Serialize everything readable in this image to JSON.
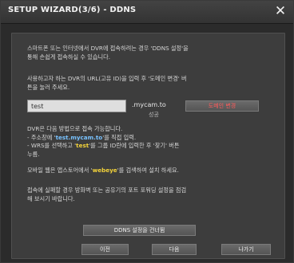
{
  "window": {
    "title": "SETUP WIZARD(3/6) - DDNS",
    "close_glyph": "✕"
  },
  "intro": "스마트폰 또는 인터넷에서 DVR에 접속하려는 경우 'DDNS 설정'을\n통해 손쉽게 접속하실 수 있습니다.",
  "url_help": "사용하고자 하는 DVR의 URL(고유 ID)을 입력 후 '도메인 변경' 버\n튼을 눌러 주세요.",
  "domain": {
    "value": "test",
    "suffix": ".mycam.to",
    "status": "성공",
    "change_button": "도메인 변경"
  },
  "access": {
    "line1": "DVR은 다음 방법으로 접속 가능합니다.",
    "line2_pre": "- 주소창에 '",
    "line2_hl": "test.mycam.to",
    "line2_post": "'를 직접 입력.",
    "line3_pre": "- WRS를 선택하고 '",
    "line3_hl": "test",
    "line3_post": "'를 그룹 ID란에 입력한 후 '찾기' 버튼",
    "line4": "누름."
  },
  "mobile": {
    "pre": "모바일 웹은 앱스토어에서 '",
    "hl": "webeye",
    "post": "'를 검색하여 설치 하세요."
  },
  "failure_note": "접속에 실패할 경우 방화벽 또는 공유기의 포트 포워딩 설정을 점검\n해 보시기 바랍니다.",
  "buttons": {
    "skip": "DDNS 설정을 건너뜀",
    "prev": "이전",
    "next": "다음",
    "exit": "나가기"
  },
  "colors": {
    "highlight_yellow": "#f2d23a",
    "highlight_blue": "#78c2ff",
    "accent_red": "#ff5a5a"
  }
}
